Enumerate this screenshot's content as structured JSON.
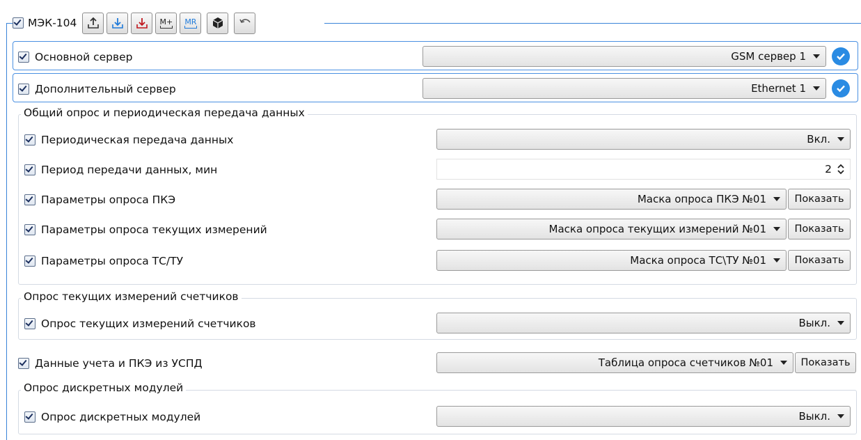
{
  "header": {
    "title": "МЭК-104"
  },
  "toolbar": {
    "upload": "upload-icon",
    "download_blue": "download-icon",
    "download_red": "download-red-icon",
    "mplus_label": "M+",
    "mr_label": "MR",
    "box": "box-icon",
    "undo": "undo-icon"
  },
  "servers": {
    "main": {
      "label": "Основной сервер",
      "value": "GSM сервер 1"
    },
    "extra": {
      "label": "Дополнительный сервер",
      "value": "Ethernet 1"
    }
  },
  "group_general": {
    "title": "Общий опрос и периодическая передача данных",
    "periodic": {
      "label": "Периодическая передача данных",
      "value": "Вкл."
    },
    "period": {
      "label": "Период передачи данных, мин",
      "value": "2"
    },
    "pke": {
      "label": "Параметры опроса ПКЭ",
      "value": "Маска опроса ПКЭ №01",
      "button": "Показать"
    },
    "current": {
      "label": "Параметры опроса текущих измерений",
      "value": "Маска опроса текущих измерений №01",
      "button": "Показать"
    },
    "tsu": {
      "label": "Параметры опроса ТС/ТУ",
      "value": "Маска опроса ТС\\ТУ №01",
      "button": "Показать"
    }
  },
  "group_meters": {
    "title": "Опрос текущих измерений счетчиков",
    "meters": {
      "label": "Опрос текущих измерений счетчиков",
      "value": "Выкл."
    }
  },
  "uspd": {
    "label": "Данные учета и ПКЭ из УСПД",
    "value": "Таблица опроса счетчиков №01",
    "button": "Показать"
  },
  "group_discrete": {
    "title": "Опрос дискретных модулей",
    "discrete": {
      "label": "Опрос дискретных модулей",
      "value": "Выкл."
    }
  },
  "colors": {
    "accent": "#2a8be3",
    "frame": "#3a84d8"
  }
}
